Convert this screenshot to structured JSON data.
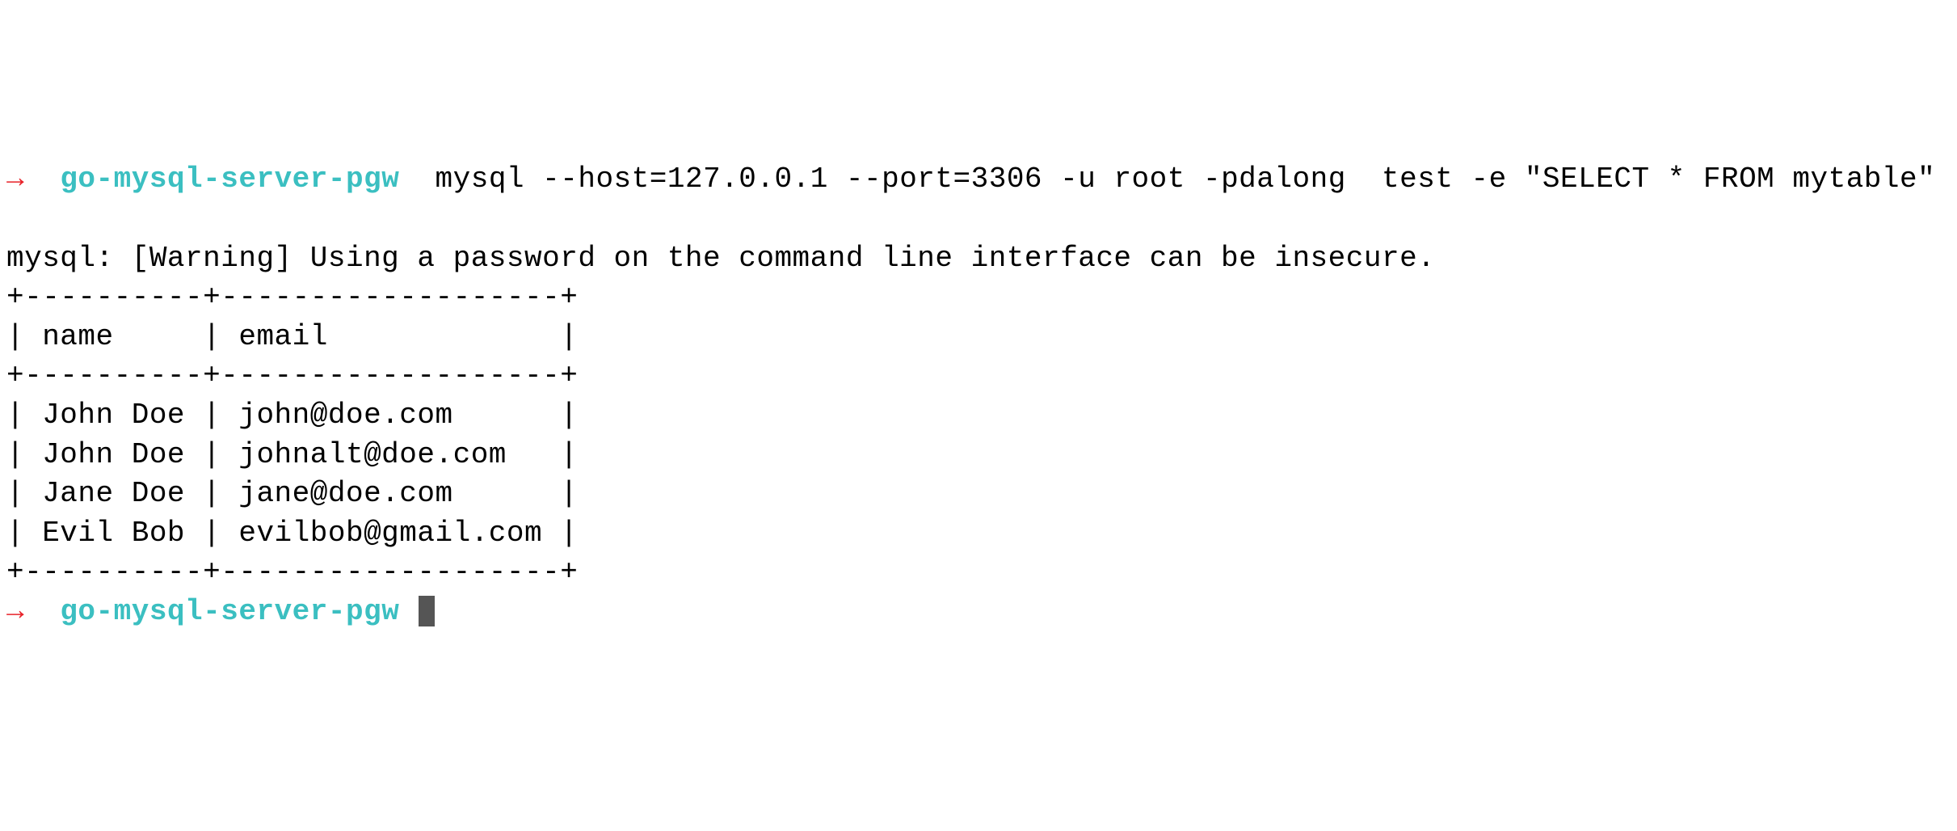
{
  "prompt1": {
    "arrow": "→",
    "dir": "go-mysql-server-pgw",
    "command": "mysql --host=127.0.0.1 --port=3306 -u root -pdalong  test -e \"SELECT * FROM mytable\""
  },
  "output": {
    "warning": "mysql: [Warning] Using a password on the command line interface can be insecure.",
    "table": {
      "rule": "+----------+-------------------+",
      "header": "| name     | email             |",
      "rows": [
        "| John Doe | john@doe.com      |",
        "| John Doe | johnalt@doe.com   |",
        "| Jane Doe | jane@doe.com      |",
        "| Evil Bob | evilbob@gmail.com |"
      ]
    }
  },
  "prompt2": {
    "arrow": "→",
    "dir": "go-mysql-server-pgw"
  },
  "chart_data": {
    "type": "table",
    "columns": [
      "name",
      "email"
    ],
    "rows": [
      {
        "name": "John Doe",
        "email": "john@doe.com"
      },
      {
        "name": "John Doe",
        "email": "johnalt@doe.com"
      },
      {
        "name": "Jane Doe",
        "email": "jane@doe.com"
      },
      {
        "name": "Evil Bob",
        "email": "evilbob@gmail.com"
      }
    ]
  }
}
